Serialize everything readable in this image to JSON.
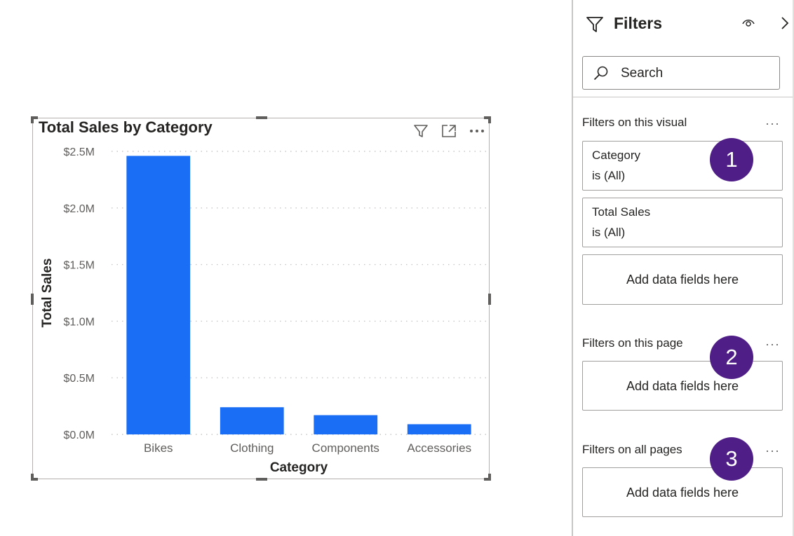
{
  "visual": {
    "title": "Total Sales by Category",
    "header_icons": [
      "filter-icon",
      "focus-mode-icon",
      "more-options-icon"
    ]
  },
  "chart_data": {
    "type": "bar",
    "categories": [
      "Bikes",
      "Clothing",
      "Components",
      "Accessories"
    ],
    "values": [
      2.46,
      0.24,
      0.17,
      0.09
    ],
    "value_unit": "$M",
    "y_ticks": [
      "$0.0M",
      "$0.5M",
      "$1.0M",
      "$1.5M",
      "$2.0M",
      "$2.5M"
    ],
    "ylim": [
      0,
      2.5
    ],
    "xlabel": "Category",
    "ylabel": "Total Sales",
    "grid": "horizontal dotted",
    "bar_color": "#1a6ef5"
  },
  "filters_pane": {
    "title": "Filters",
    "search_placeholder": "Search",
    "sections": {
      "visual": {
        "title": "Filters on this visual",
        "more": "···",
        "cards": [
          {
            "field": "Category",
            "condition": "is (All)"
          },
          {
            "field": "Total Sales",
            "condition": "is (All)"
          }
        ],
        "add_label": "Add data fields here"
      },
      "page": {
        "title": "Filters on this page",
        "more": "···",
        "add_label": "Add data fields here"
      },
      "all_pages": {
        "title": "Filters on all pages",
        "more": "···",
        "add_label": "Add data fields here"
      }
    }
  },
  "badges": [
    "1",
    "2",
    "3"
  ],
  "colors": {
    "badge": "#4f1f87",
    "bar": "#1a6ef5"
  }
}
